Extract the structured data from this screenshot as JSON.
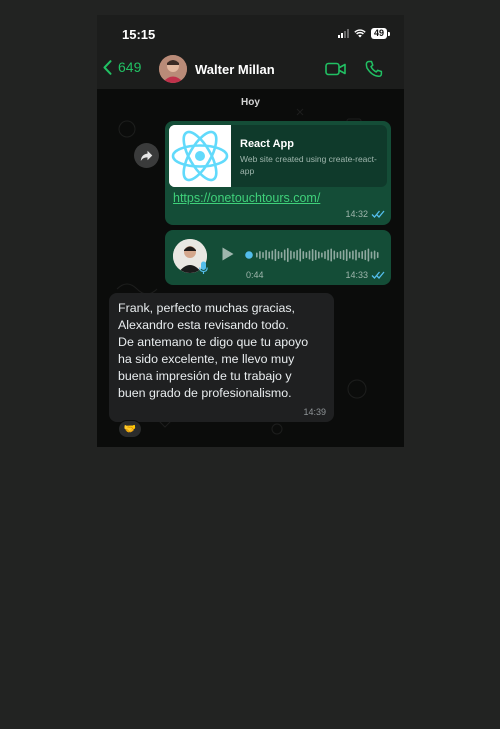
{
  "status_bar": {
    "time": "15:15",
    "battery": "49"
  },
  "header": {
    "back_count": "649",
    "contact_name": "Walter Millan"
  },
  "chat": {
    "day_label": "Hoy",
    "link_message": {
      "preview_title": "React App",
      "preview_description": "Web site created using create-react-app",
      "url": "https://onetouchtours.com/",
      "time": "14:32"
    },
    "voice_message": {
      "duration": "0:44",
      "time": "14:33"
    },
    "text_message": {
      "body": "Frank, perfecto muchas gracias,\nAlexandro esta revisando todo.\nDe antemano te digo que tu apoyo\nha sido excelente, me llevo muy\nbuena impresión de tu trabajo y\nbuen grado de profesionalismo.",
      "time": "14:39",
      "reaction": "🤝"
    }
  },
  "icons": {
    "back": "chevron-left-icon",
    "video": "video-call-icon",
    "call": "phone-icon",
    "forward": "forward-icon",
    "play": "play-icon",
    "mic": "mic-icon",
    "read": "double-check-icon"
  },
  "colors": {
    "accent": "#21c063",
    "outgoing_bubble": "#144d37",
    "incoming_bubble": "#1f2021",
    "read_receipt": "#53bdeb",
    "react_logo": "#61dafb"
  }
}
